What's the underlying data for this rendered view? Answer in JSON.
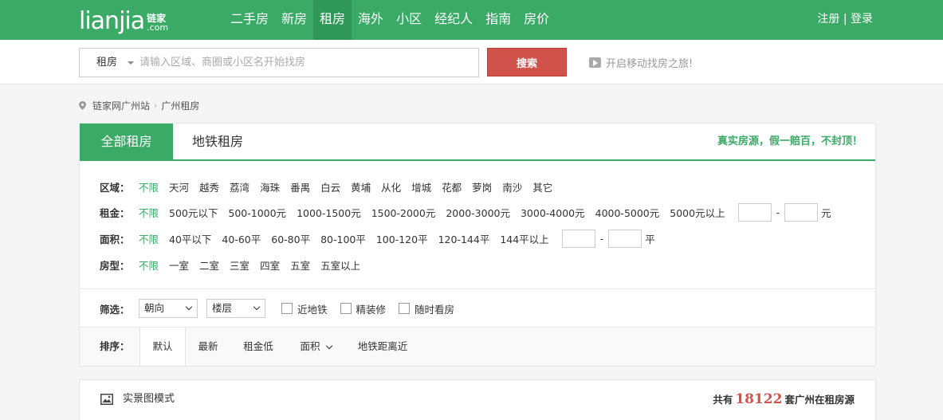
{
  "header": {
    "logo_main": "lianjia",
    "logo_cn": "链家",
    "logo_domain": ".com",
    "nav": [
      "二手房",
      "新房",
      "租房",
      "海外",
      "小区",
      "经纪人",
      "指南",
      "房价"
    ],
    "active_nav": "租房",
    "register": "注册",
    "separator": " | ",
    "login": "登录"
  },
  "search": {
    "type": "租房",
    "placeholder": "请输入区域、商圈或小区名开始找房",
    "button": "搜索",
    "mobile_link": "开启移动找房之旅!"
  },
  "breadcrumb": [
    "链家网广州站",
    "广州租房"
  ],
  "tabs": {
    "all": "全部租房",
    "subway": "地铁租房",
    "promo": "真实房源，假一赔百，不封顶！"
  },
  "filters": {
    "area": {
      "label": "区域：",
      "options": [
        "不限",
        "天河",
        "越秀",
        "荔湾",
        "海珠",
        "番禺",
        "白云",
        "黄埔",
        "从化",
        "增城",
        "花都",
        "萝岗",
        "南沙",
        "其它"
      ]
    },
    "rent": {
      "label": "租金：",
      "options": [
        "不限",
        "500元以下",
        "500-1000元",
        "1000-1500元",
        "1500-2000元",
        "2000-3000元",
        "3000-4000元",
        "4000-5000元",
        "5000元以上"
      ],
      "unit": "元"
    },
    "size": {
      "label": "面积：",
      "options": [
        "不限",
        "40平以下",
        "40-60平",
        "60-80平",
        "80-100平",
        "100-120平",
        "120-144平",
        "144平以上"
      ],
      "unit": "平"
    },
    "room": {
      "label": "房型：",
      "options": [
        "不限",
        "一室",
        "二室",
        "三室",
        "四室",
        "五室",
        "五室以上"
      ]
    },
    "range_dash": "-"
  },
  "screen": {
    "label": "筛选：",
    "orientation": "朝向",
    "floor": "楼层",
    "checks": [
      "近地铁",
      "精装修",
      "随时看房"
    ]
  },
  "sort": {
    "label": "排序：",
    "items": [
      "默认",
      "最新",
      "租金低",
      "面积",
      "地铁距离近"
    ],
    "active": "默认"
  },
  "results": {
    "mode": "实景图模式",
    "prefix": "共有",
    "count": "18122",
    "suffix": "套广州在租房源"
  },
  "colors": {
    "brand_green": "#3aaa66",
    "search_red": "#d0524b"
  }
}
